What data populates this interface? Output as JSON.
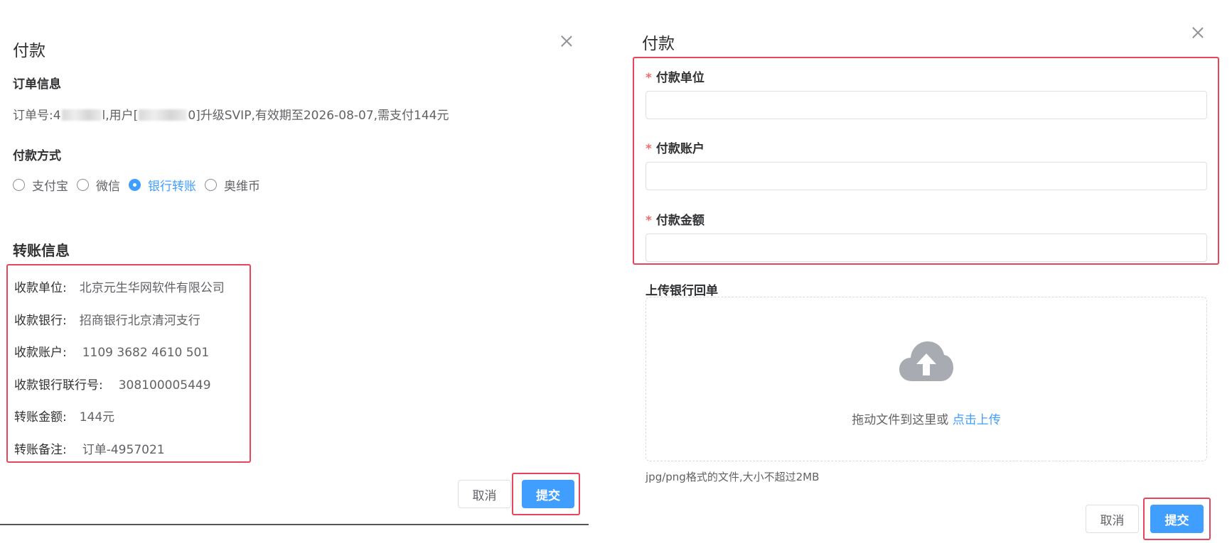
{
  "left": {
    "title": "付款",
    "order_section_label": "订单信息",
    "order_prefix": "订单号:4",
    "order_mid": "l,用户[",
    "order_suffix": "0]升级SVIP,有效期至2026-08-07,需支付144元",
    "payment_method_label": "付款方式",
    "payment_options": [
      "支付宝",
      "微信",
      "银行转账",
      "奥维币"
    ],
    "payment_selected": "银行转账",
    "transfer_title": "转账信息",
    "transfer_info": [
      {
        "key": "收款单位:",
        "value": "北京元生华网软件有限公司"
      },
      {
        "key": "收款银行:",
        "value": "招商银行北京清河支行"
      },
      {
        "key": "收款账户:",
        "value": "1109 3682 4610 501"
      },
      {
        "key": "收款银行联行号:",
        "value": "308100005449"
      },
      {
        "key": "转账金额:",
        "value": "144元"
      },
      {
        "key": "转账备注:",
        "value": "订单-4957021"
      }
    ],
    "cancel_label": "取消",
    "submit_label": "提交"
  },
  "right": {
    "title": "付款",
    "fields": [
      {
        "label": "付款单位",
        "required": true,
        "value": ""
      },
      {
        "label": "付款账户",
        "required": true,
        "value": ""
      },
      {
        "label": "付款金额",
        "required": true,
        "value": ""
      }
    ],
    "upload_label": "上传银行回单",
    "upload_text": "拖动文件到这里或",
    "upload_link": "点击上传",
    "upload_hint": "jpg/png格式的文件,大小不超过2MB",
    "cancel_label": "取消",
    "submit_label": "提交"
  },
  "colors": {
    "primary": "#409eff",
    "highlight_border": "#e8445a",
    "required": "#f56c6c",
    "upload_icon": "#a8abb2"
  },
  "icons": {
    "close": "close-icon",
    "upload": "cloud-upload-icon"
  }
}
